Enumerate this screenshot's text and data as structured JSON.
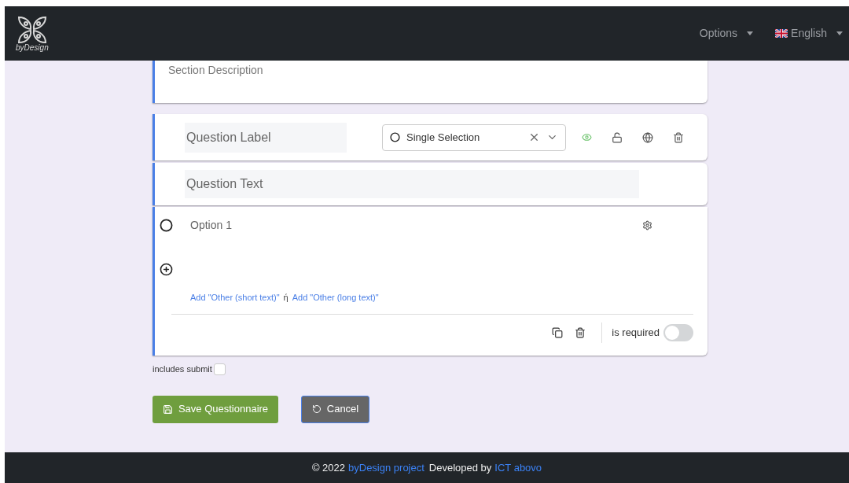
{
  "navbar": {
    "brand": "byDesign",
    "menus": [
      {
        "kind": "menu",
        "label": "Options"
      },
      {
        "kind": "language",
        "label": "English"
      }
    ]
  },
  "section": {
    "description_placeholder": "Section Description"
  },
  "question": {
    "label_placeholder": "Question Label",
    "type": "Single Selection",
    "visible": true,
    "text_placeholder": "Question Text",
    "options": [
      {
        "placeholder": "Option 1"
      }
    ],
    "add_other": {
      "short": "Add \"Other (short text)\"",
      "separator": "ή",
      "long": "Add \"Other (long text)\""
    },
    "required_label": "is required",
    "required": false
  },
  "includes_submit": {
    "label": "includes submit",
    "checked": false
  },
  "buttons": [
    {
      "kind": "save",
      "label": "Save Questionnaire"
    },
    {
      "kind": "cancel",
      "label": "Cancel"
    }
  ],
  "footer": {
    "copyright": "© 2022",
    "project_link": "byDesign project",
    "developed_by": "Developed by",
    "developer_link": "ICT abovo"
  }
}
